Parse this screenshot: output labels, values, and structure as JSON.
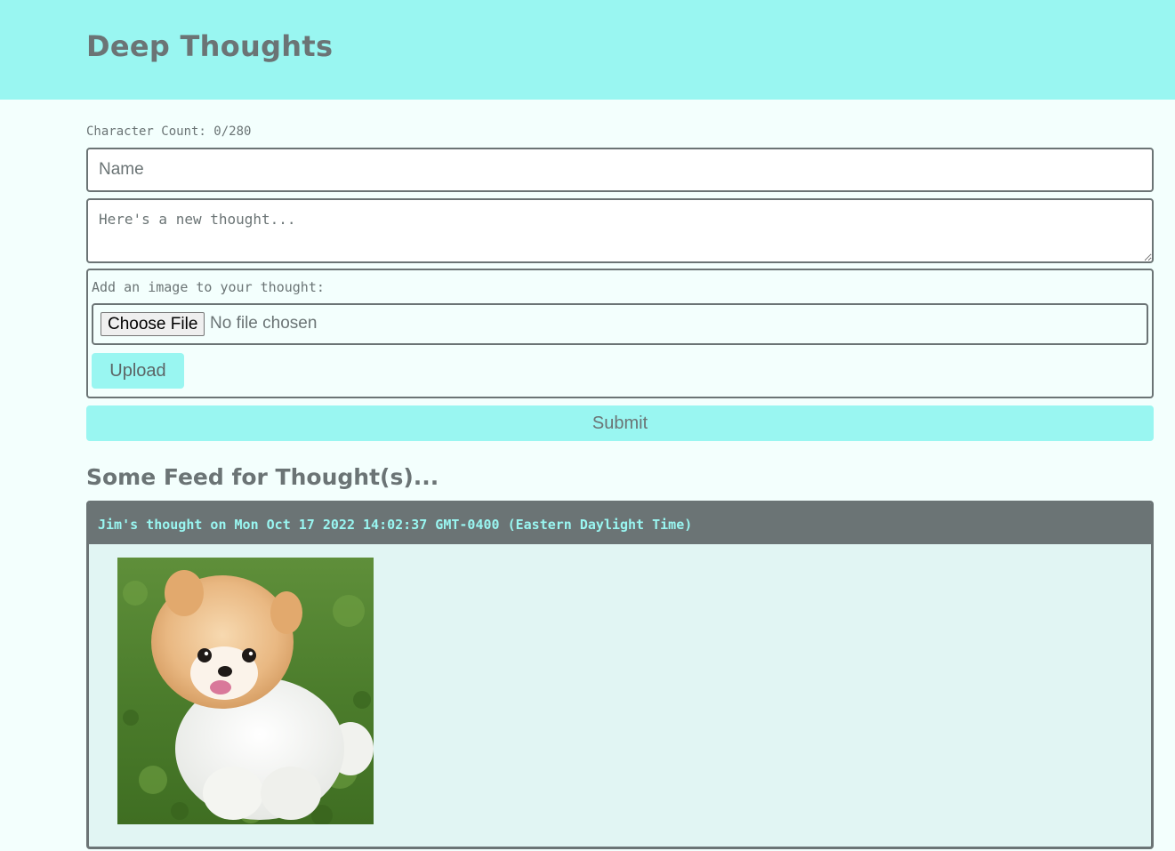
{
  "header": {
    "title": "Deep Thoughts"
  },
  "form": {
    "character_count": "Character Count: 0/280",
    "name_placeholder": "Name",
    "thought_placeholder": "Here's a new thought...",
    "image_label": "Add an image to your thought:",
    "choose_file_label": "Choose File",
    "file_status": "No file chosen",
    "upload_label": "Upload",
    "submit_label": "Submit"
  },
  "feed": {
    "title": "Some Feed for Thought(s)...",
    "thoughts": [
      {
        "header": "Jim's thought on Mon Oct 17 2022 14:02:37 GMT-0400 (Eastern Daylight Time)",
        "image": "pomeranian-dog-photo"
      }
    ]
  },
  "colors": {
    "accent": "#99f6f1",
    "text": "#6b7475",
    "background": "#f3fffd",
    "card_background": "#e1f5f3"
  }
}
